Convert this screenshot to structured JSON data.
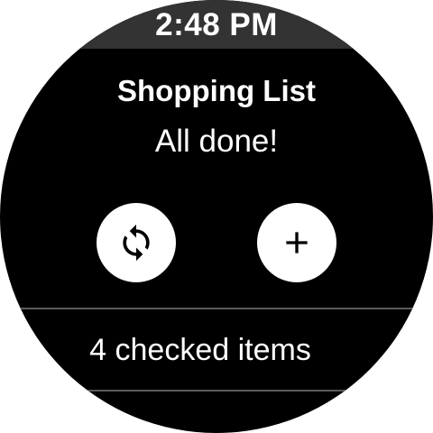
{
  "status_bar": {
    "time": "2:48 PM"
  },
  "header": {
    "title": "Shopping List",
    "subtitle": "All done!"
  },
  "actions": {
    "refresh_icon": "refresh-icon",
    "add_icon": "add-icon"
  },
  "list": {
    "checked_items_label": "4 checked items"
  },
  "colors": {
    "background": "#000000",
    "status_bar": "#333333",
    "button": "#ffffff",
    "icon": "#000000",
    "divider": "#5a5a5a"
  }
}
